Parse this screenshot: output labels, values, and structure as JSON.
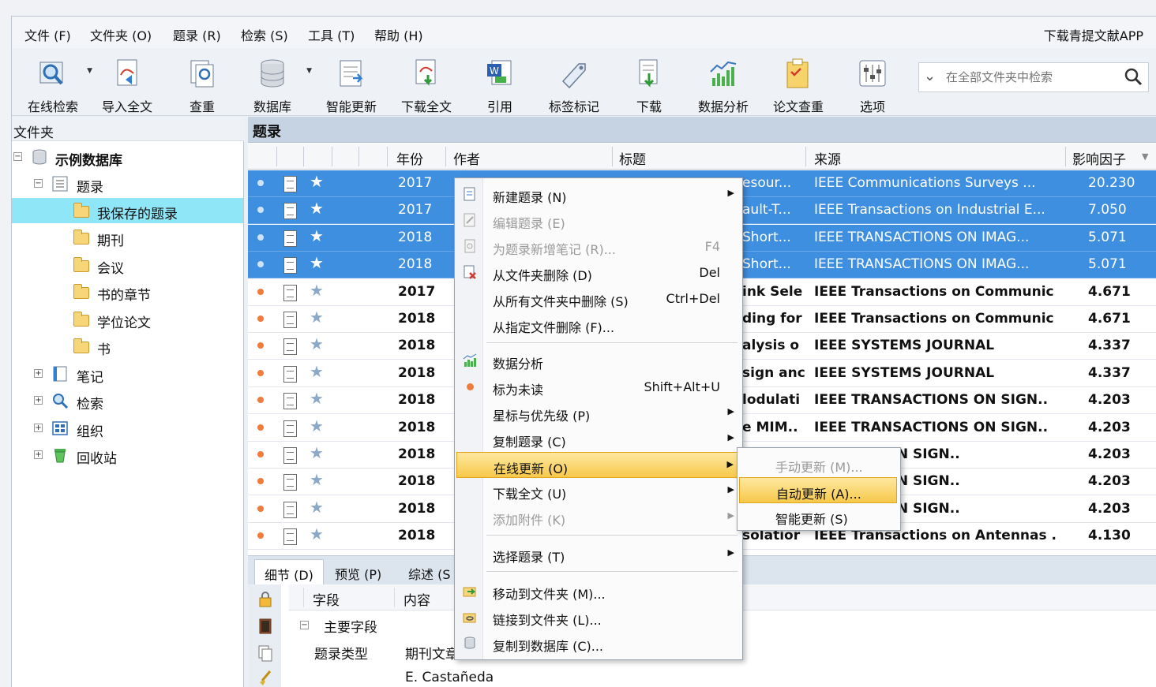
{
  "menu": [
    "文件 (F)",
    "文件夹 (O)",
    "题录 (R)",
    "检索 (S)",
    "工具 (T)",
    "帮助 (H)"
  ],
  "app_link": "下载青提文献APP",
  "toolbar": [
    "在线检索",
    "导入全文",
    "查重",
    "数据库",
    "智能更新",
    "下载全文",
    "引用",
    "标签标记",
    "下载",
    "数据分析",
    "论文查重",
    "选项"
  ],
  "search": {
    "placeholder": "在全部文件夹中检索"
  },
  "left": {
    "header": "文件夹",
    "root": "示例数据库",
    "records": "题录",
    "children": [
      "我保存的题录",
      "期刊",
      "会议",
      "书的章节",
      "学位论文",
      "书"
    ],
    "groups": [
      "笔记",
      "检索",
      "组织",
      "回收站"
    ]
  },
  "main": {
    "header": "题录",
    "columns": [
      "年份",
      "作者",
      "标题",
      "来源",
      "影响因子"
    ],
    "rows": [
      {
        "year": "2017",
        "title": "esour...",
        "source": "IEEE Communications Surveys ...",
        "if": "20.230"
      },
      {
        "year": "2017",
        "title": "ault-T...",
        "source": "IEEE Transactions on Industrial E...",
        "if": "7.050"
      },
      {
        "year": "2018",
        "title": "Short...",
        "source": "IEEE TRANSACTIONS ON IMAG...",
        "if": "5.071"
      },
      {
        "year": "2018",
        "title": "Short...",
        "source": "IEEE TRANSACTIONS ON IMAG...",
        "if": "5.071"
      },
      {
        "year": "2017",
        "title": "ink Sele",
        "source": "IEEE Transactions on Communic",
        "if": "4.671"
      },
      {
        "year": "2018",
        "title": "ding for",
        "source": "IEEE Transactions on Communic",
        "if": "4.671"
      },
      {
        "year": "2018",
        "title": "alysis o",
        "source": "IEEE SYSTEMS JOURNAL",
        "if": "4.337"
      },
      {
        "year": "2018",
        "title": "sign anc",
        "source": "IEEE SYSTEMS JOURNAL",
        "if": "4.337"
      },
      {
        "year": "2018",
        "title": "lodulati",
        "source": "IEEE TRANSACTIONS ON SIGN..",
        "if": "4.203"
      },
      {
        "year": "2018",
        "title": "e MIM..",
        "source": "IEEE TRANSACTIONS ON SIGN..",
        "if": "4.203"
      },
      {
        "year": "2018",
        "title": "",
        "source": "ACTIONS ON SIGN..",
        "if": "4.203"
      },
      {
        "year": "2018",
        "title": "",
        "source": "ACTIONS ON SIGN..",
        "if": "4.203"
      },
      {
        "year": "2018",
        "title": "",
        "source": "ACTIONS ON SIGN..",
        "if": "4.203"
      },
      {
        "year": "2018",
        "title": "solatior",
        "source": "IEEE Transactions on Antennas .",
        "if": "4.130"
      }
    ]
  },
  "tabs": [
    "细节 (D)",
    "预览 (P)",
    "综述 (S"
  ],
  "detail": {
    "col1": "字段",
    "col2": "内容",
    "group": "主要字段",
    "field": "题录类型",
    "value": "期刊文章",
    "author": "E. Castañeda"
  },
  "context_menu": [
    {
      "label": "新建题录 (N)",
      "key": "",
      "arrow": "▶"
    },
    {
      "label": "编辑题录 (E)",
      "key": "",
      "arrow": ""
    },
    {
      "label": "为题录新增笔记 (R)...",
      "key": "F4",
      "arrow": ""
    },
    {
      "label": "从文件夹删除 (D)",
      "key": "Del",
      "arrow": ""
    },
    {
      "label": "从所有文件夹中删除 (S)",
      "key": "Ctrl+Del",
      "arrow": ""
    },
    {
      "label": "从指定文件删除 (F)...",
      "key": "",
      "arrow": ""
    },
    {
      "label": "数据分析",
      "key": "",
      "arrow": ""
    },
    {
      "label": "标为未读",
      "key": "Shift+Alt+U",
      "arrow": ""
    },
    {
      "label": "星标与优先级 (P)",
      "key": "",
      "arrow": "▶"
    },
    {
      "label": "复制题录 (C)",
      "key": "",
      "arrow": "▶"
    },
    {
      "label": "在线更新 (O)",
      "key": "",
      "arrow": "▶"
    },
    {
      "label": "下载全文 (U)",
      "key": "",
      "arrow": "▶"
    },
    {
      "label": "添加附件 (K)",
      "key": "",
      "arrow": "▶"
    },
    {
      "label": "选择题录 (T)",
      "key": "",
      "arrow": "▶"
    },
    {
      "label": "移动到文件夹 (M)...",
      "key": "",
      "arrow": ""
    },
    {
      "label": "链接到文件夹 (L)...",
      "key": "",
      "arrow": ""
    },
    {
      "label": "复制到数据库 (C)...",
      "key": "",
      "arrow": ""
    }
  ],
  "submenu": [
    "手动更新 (M)...",
    "自动更新 (A)...",
    "智能更新 (S)"
  ]
}
